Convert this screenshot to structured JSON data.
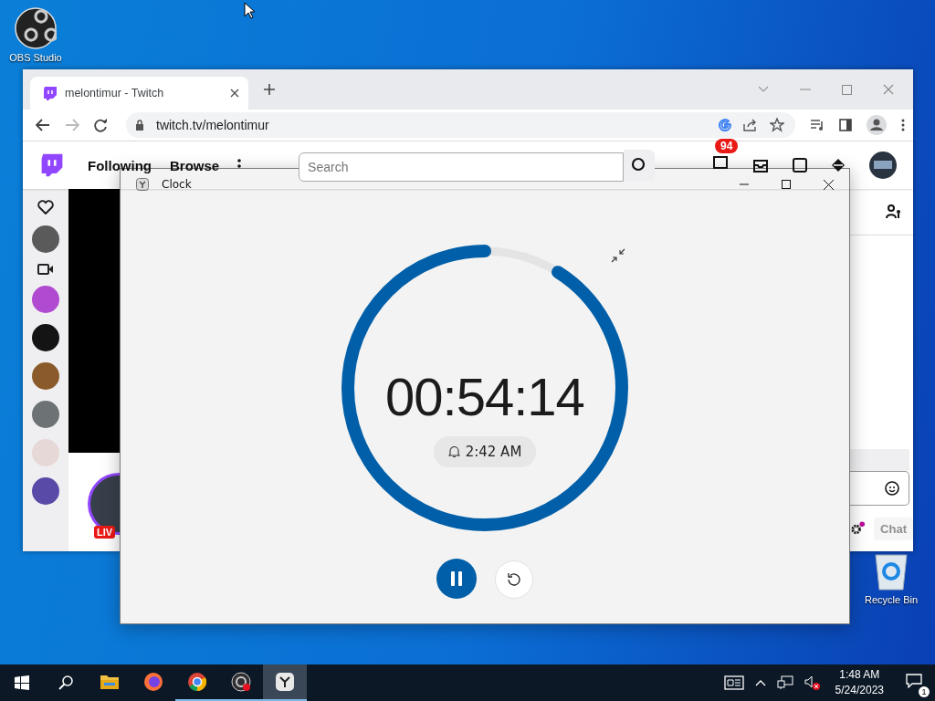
{
  "desktop_icons": [
    {
      "kind": "obs",
      "label": "OBS Studio"
    },
    {
      "kind": "recycle",
      "label": "Recycle Bin"
    }
  ],
  "browser": {
    "tabs": [
      {
        "title": "melontimur - Twitch",
        "selected": true
      }
    ],
    "url": "twitch.tv/melontimur",
    "twitch": {
      "nav": [
        {
          "label": "Following"
        },
        {
          "label": "Browse"
        }
      ],
      "search": {
        "placeholder": "Search"
      },
      "notification_count": "94",
      "sidebar": [
        {
          "kind": "heart"
        },
        {
          "kind": "avatar",
          "color": "#5a5a5a"
        },
        {
          "kind": "camera"
        },
        {
          "kind": "avatar",
          "color": "#b04ad0"
        },
        {
          "kind": "avatar",
          "color": "#141414"
        },
        {
          "kind": "avatar",
          "color": "#8a5a2a"
        },
        {
          "kind": "avatar",
          "color": "#6d7275"
        },
        {
          "kind": "avatar",
          "color": "#e6d8d6"
        },
        {
          "kind": "avatar",
          "color": "#5a4aa8"
        }
      ],
      "live_badge": "LIV",
      "chat_button": "Chat"
    }
  },
  "clock": {
    "title": "Clock",
    "timer": "00:54:14",
    "level": 0.91,
    "alarm": "2:42 AM",
    "running": true
  },
  "taskbar": {
    "apps": [
      {
        "kind": "explorer",
        "running": false,
        "selected": false
      },
      {
        "kind": "firefox",
        "running": false,
        "selected": false
      },
      {
        "kind": "chrome",
        "running": true,
        "selected": false
      },
      {
        "kind": "obs",
        "running": true,
        "selected": false
      },
      {
        "kind": "clock",
        "running": true,
        "selected": true
      }
    ],
    "time": "1:48 AM",
    "date": "5/24/2023",
    "notification_count": "1"
  }
}
